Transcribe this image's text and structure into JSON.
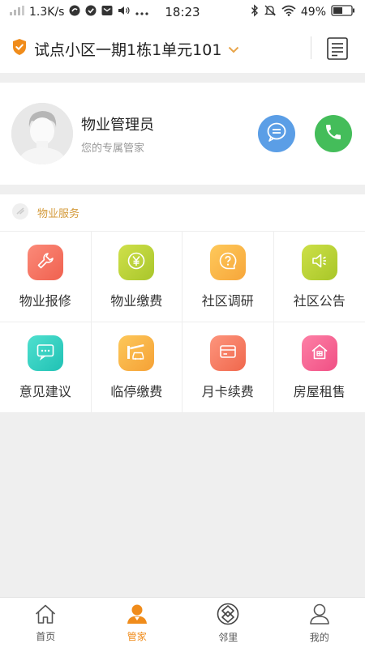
{
  "status_bar": {
    "speed": "1.3K/s",
    "time": "18:23",
    "battery": "49%"
  },
  "header": {
    "community": "试点小区一期1栋1单元101"
  },
  "manager": {
    "name": "物业管理员",
    "subtitle": "您的专属管家"
  },
  "services": {
    "title": "物业服务",
    "items": [
      {
        "label": "物业报修",
        "icon": "wrench-icon",
        "colors": [
          "#fb8a79",
          "#f0614f"
        ]
      },
      {
        "label": "物业缴费",
        "icon": "yen-icon",
        "colors": [
          "#cfe04a",
          "#a9c62b"
        ]
      },
      {
        "label": "社区调研",
        "icon": "question-icon",
        "colors": [
          "#fec95b",
          "#f7a63a"
        ]
      },
      {
        "label": "社区公告",
        "icon": "speaker-icon",
        "colors": [
          "#cde048",
          "#a8c628"
        ]
      },
      {
        "label": "意见建议",
        "icon": "message-icon",
        "colors": [
          "#4fe0cf",
          "#20c1b4"
        ]
      },
      {
        "label": "临停缴费",
        "icon": "parking-icon",
        "colors": [
          "#fdc85a",
          "#f5a136"
        ]
      },
      {
        "label": "月卡续费",
        "icon": "card-icon",
        "colors": [
          "#fd957d",
          "#f0674c"
        ]
      },
      {
        "label": "房屋租售",
        "icon": "house-icon",
        "colors": [
          "#fd80a6",
          "#f04f84"
        ]
      }
    ]
  },
  "tabbar": {
    "items": [
      {
        "label": "首页",
        "active": false
      },
      {
        "label": "管家",
        "active": true
      },
      {
        "label": "邻里",
        "active": false
      },
      {
        "label": "我的",
        "active": false
      }
    ],
    "active_color": "#f08c1b"
  }
}
